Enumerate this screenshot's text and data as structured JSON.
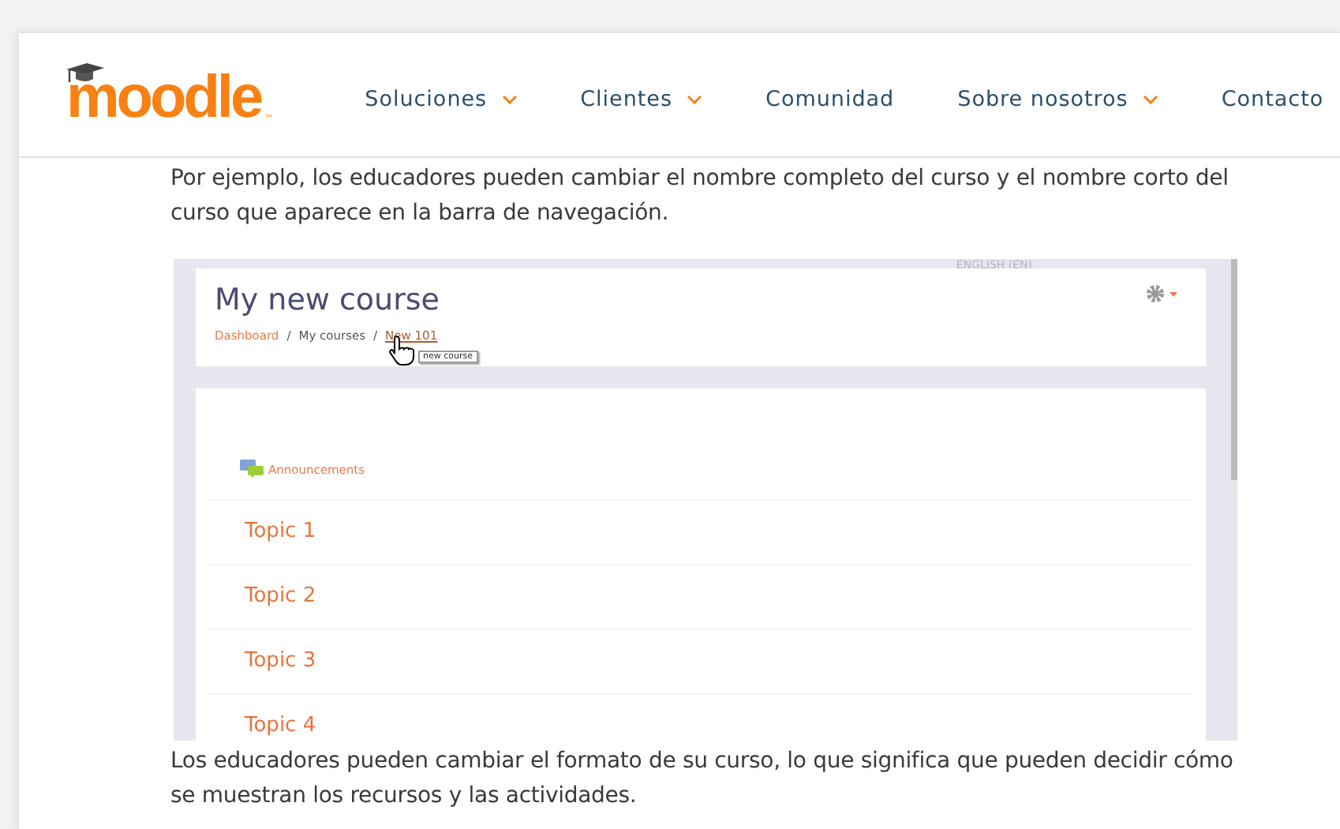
{
  "header": {
    "logo_text": "moodle",
    "logo_mark": "™",
    "nav": [
      {
        "label": "Soluciones",
        "has_menu": true
      },
      {
        "label": "Clientes",
        "has_menu": true
      },
      {
        "label": "Comunidad",
        "has_menu": false
      },
      {
        "label": "Sobre nosotros",
        "has_menu": true
      },
      {
        "label": "Contacto",
        "has_menu": false
      }
    ]
  },
  "intro": "Por ejemplo, los educadores pueden cambiar el nombre completo del curso y el nombre corto del curso que aparece en la barra de navegación.",
  "course_screenshot": {
    "language": "ENGLISH (EN)",
    "title": "My new course",
    "breadcrumb": [
      {
        "label": "Dashboard",
        "kind": "link"
      },
      {
        "label": "My courses",
        "kind": "plain"
      },
      {
        "label": "New 101",
        "kind": "current"
      }
    ],
    "separator": "/",
    "tooltip": "new course",
    "announcements": "Announcements",
    "topics": [
      "Topic 1",
      "Topic 2",
      "Topic 3",
      "Topic 4"
    ]
  },
  "outro": "Los educadores pueden cambiar el formato de su curso, lo que significa que pueden decidir cómo se muestran los recursos y las actividades."
}
